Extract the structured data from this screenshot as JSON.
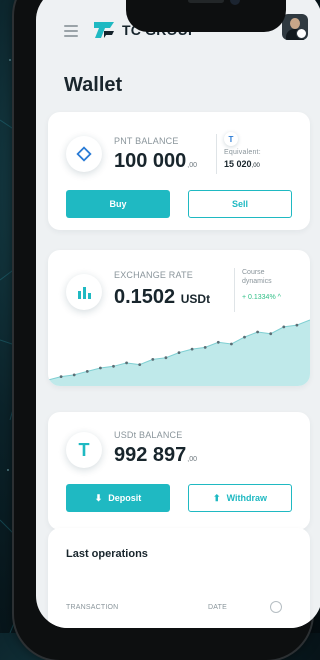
{
  "brand": {
    "name": "TC GROUP",
    "accent": "#1fb9c2"
  },
  "page": {
    "title": "Wallet"
  },
  "pnt_card": {
    "label": "PNT BALANCE",
    "value": "100 000",
    "decimals": ",00",
    "equivalent_label": "Equivalent:",
    "equivalent_value": "15 020",
    "equivalent_decimals": ",00",
    "buy_label": "Buy",
    "sell_label": "Sell"
  },
  "rate_card": {
    "label": "EXCHANGE RATE",
    "value": "0.1502",
    "unit": "USDt",
    "dynamics_label_line1": "Course",
    "dynamics_label_line2": "dynamics",
    "change": "+ 0.1334%",
    "chart_points": [
      0.02,
      0.04,
      0.05,
      0.07,
      0.09,
      0.1,
      0.12,
      0.11,
      0.14,
      0.15,
      0.18,
      0.2,
      0.21,
      0.24,
      0.23,
      0.27,
      0.3,
      0.29,
      0.33,
      0.34,
      0.37
    ]
  },
  "usdt_card": {
    "label": "USDt BALANCE",
    "value": "992 897",
    "decimals": ",00",
    "deposit_label": "Deposit",
    "withdraw_label": "Withdraw"
  },
  "operations": {
    "title": "Last operations",
    "col_transaction": "TRANSACTION",
    "col_date": "DATE"
  }
}
